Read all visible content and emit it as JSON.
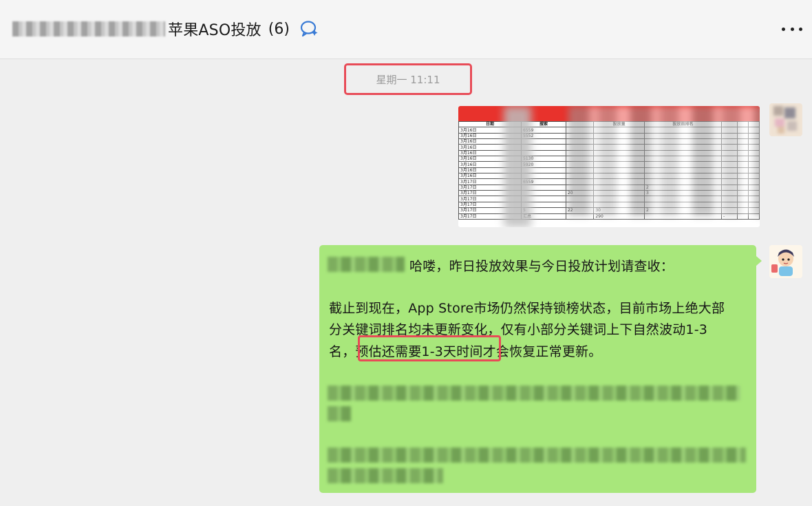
{
  "header": {
    "title_visible": "苹果ASO投放",
    "member_count": "(6)"
  },
  "chat": {
    "timestamp": "星期一 11:11",
    "image_table": {
      "headers": [
        "日期",
        "搜索",
        "",
        "投放量",
        "投放前排名",
        "",
        "",
        ""
      ],
      "rows": [
        [
          "3月16日",
          "6559",
          "",
          "",
          "",
          "",
          "",
          ""
        ],
        [
          "3月16日",
          "5552",
          "",
          "",
          "",
          "",
          "",
          ""
        ],
        [
          "3月16日",
          "",
          "",
          "",
          "",
          "",
          "",
          ""
        ],
        [
          "3月16日",
          "",
          "",
          "",
          "",
          "",
          "",
          ""
        ],
        [
          "3月16日",
          "",
          "",
          "",
          "",
          "",
          "",
          ""
        ],
        [
          "3月16日",
          "5130",
          "",
          "",
          "",
          "",
          "",
          ""
        ],
        [
          "3月16日",
          "5920",
          "",
          "",
          "",
          "",
          "",
          ""
        ],
        [
          "3月16日",
          "",
          "",
          "",
          "",
          "",
          "",
          ""
        ],
        [
          "3月16日",
          "",
          "",
          "",
          "",
          "",
          "",
          ""
        ],
        [
          "3月17日",
          "6559",
          "",
          "",
          "",
          "",
          "",
          ""
        ],
        [
          "3月17日",
          "",
          "",
          "",
          "2",
          "",
          "",
          ""
        ],
        [
          "3月17日",
          "",
          "20",
          "",
          "3",
          "",
          "",
          ""
        ],
        [
          "3月17日",
          "",
          "",
          "",
          "",
          "",
          "",
          ""
        ],
        [
          "3月17日",
          "",
          "",
          "",
          "",
          "",
          "",
          ""
        ],
        [
          "3月17日",
          "5",
          "22",
          "30",
          "2",
          "",
          "",
          ""
        ],
        [
          "3月17日",
          "汇总",
          "",
          "290",
          "",
          "-",
          "",
          ""
        ]
      ]
    },
    "message": {
      "line1": "哈喽，昨日投放效果与今日投放计划请查收：",
      "line2": "截止到现在，App Store市场仍然保持锁榜状态，目前市场上绝大部",
      "line3": "分关键词排名均未更新变化，仅有小部分关键词上下自然波动1-3",
      "line4": "名，预估还需要1-3天时间才会恢复正常更新。"
    }
  },
  "colors": {
    "bubble_green": "#a8e77b",
    "highlight_red": "#e84b57",
    "image_red_bar": "#e8322c"
  }
}
